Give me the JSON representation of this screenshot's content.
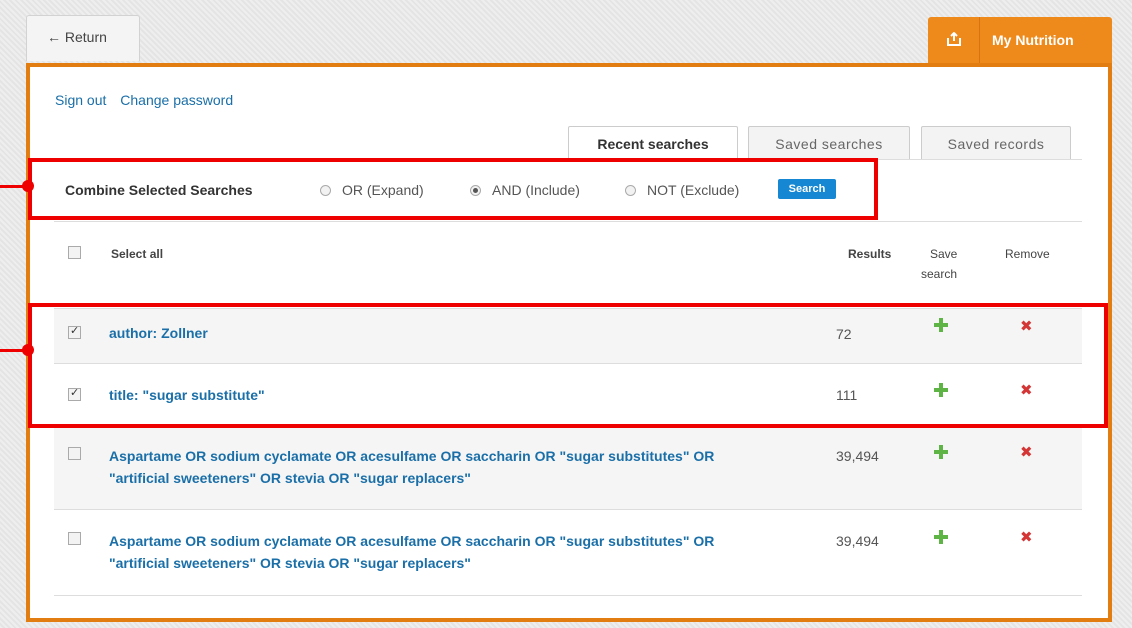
{
  "header": {
    "return_label": "← Return",
    "my_nutrition_label": "My Nutrition",
    "my_nutrition_icon": "export-icon"
  },
  "account": {
    "sign_out": "Sign out",
    "change_password": "Change password"
  },
  "tabs": [
    {
      "label": "Recent searches",
      "active": true
    },
    {
      "label": "Saved searches",
      "active": false
    },
    {
      "label": "Saved records",
      "active": false
    }
  ],
  "combine": {
    "label": "Combine Selected Searches",
    "options": [
      {
        "label": "OR (Expand)",
        "selected": false
      },
      {
        "label": "AND (Include)",
        "selected": true
      },
      {
        "label": "NOT (Exclude)",
        "selected": false
      }
    ],
    "search_button": "Search"
  },
  "table": {
    "select_all": "Select all",
    "col_results": "Results",
    "col_save_line1": "Save",
    "col_save_line2": "search",
    "col_remove": "Remove",
    "rows": [
      {
        "checked": true,
        "query": "author: Zollner",
        "results": "72"
      },
      {
        "checked": true,
        "query": "title: \"sugar substitute\"",
        "results": "111"
      },
      {
        "checked": false,
        "query_line1": "Aspartame OR sodium cyclamate OR acesulfame OR saccharin OR \"sugar substitutes\" OR",
        "query_line2": "\"artificial sweeteners\" OR stevia OR \"sugar replacers\"",
        "results": "39,494"
      },
      {
        "checked": false,
        "query_line1": "Aspartame OR sodium cyclamate OR acesulfame OR saccharin OR \"sugar substitutes\" OR",
        "query_line2": "\"artificial sweeteners\" OR stevia OR \"sugar replacers\"",
        "results": "39,494"
      }
    ]
  },
  "colors": {
    "accent_orange": "#ee8a1b",
    "link_blue": "#1a6fa8",
    "callout_red": "#ee0000",
    "add_green": "#5eb546",
    "remove_red": "#d43535"
  }
}
